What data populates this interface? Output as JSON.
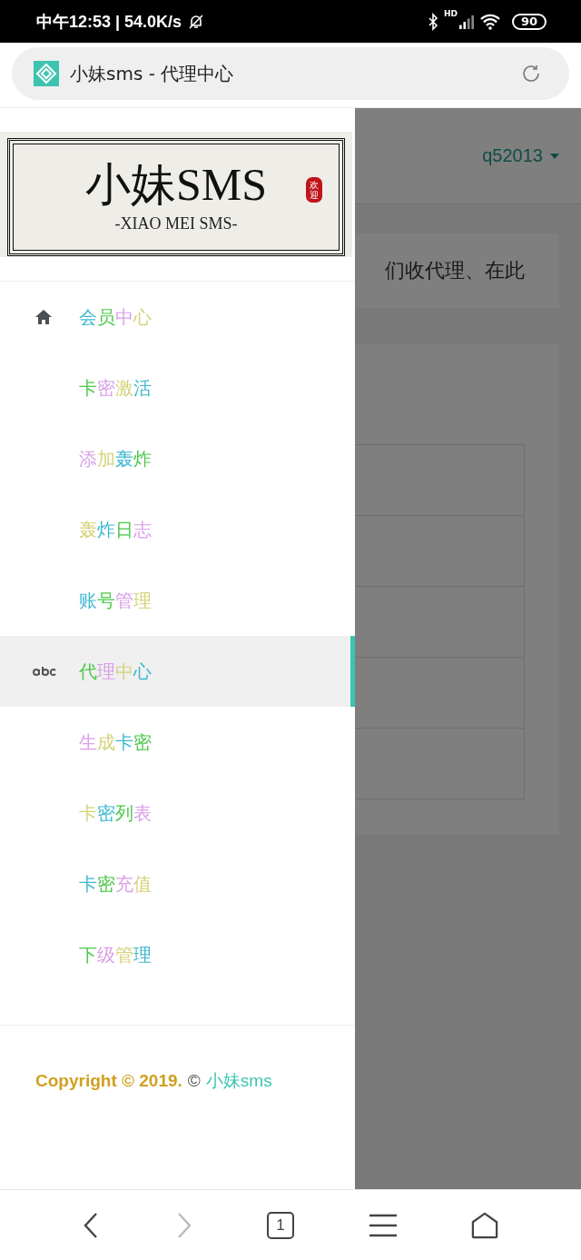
{
  "status_bar": {
    "time": "中午12:53 | 54.0K/s",
    "network": "HD",
    "battery": "90"
  },
  "address_bar": {
    "title": "小妹sms - 代理中心"
  },
  "page_behind": {
    "user": "q52013",
    "notice": "们收代理、在此"
  },
  "drawer": {
    "logo": {
      "title": "小妹SMS",
      "subtitle": "-XIAO MEI SMS-",
      "seal": "欢迎"
    },
    "items": [
      {
        "label": "会员中心",
        "kind": "home",
        "selected": false
      },
      {
        "label": "卡密激活",
        "kind": "plain",
        "selected": false
      },
      {
        "label": "添加轰炸",
        "kind": "plain",
        "selected": false
      },
      {
        "label": "轰炸日志",
        "kind": "plain",
        "selected": false
      },
      {
        "label": "账号管理",
        "kind": "plain",
        "selected": false
      },
      {
        "label": "代理中心",
        "kind": "abc",
        "selected": true
      },
      {
        "label": "生成卡密",
        "kind": "plain",
        "selected": false
      },
      {
        "label": "卡密列表",
        "kind": "plain",
        "selected": false
      },
      {
        "label": "卡密充值",
        "kind": "plain",
        "selected": false
      },
      {
        "label": "下级管理",
        "kind": "plain",
        "selected": false
      }
    ],
    "footer": {
      "copyright": "Copyright © 2019.",
      "mark": "©",
      "brand": "小妹sms"
    }
  },
  "bottom_nav": [
    {
      "kind": "back",
      "disabled": false
    },
    {
      "kind": "forward",
      "disabled": true
    },
    {
      "kind": "tabs",
      "count": "1",
      "disabled": false
    },
    {
      "kind": "menu",
      "disabled": false
    },
    {
      "kind": "home",
      "disabled": false
    }
  ]
}
